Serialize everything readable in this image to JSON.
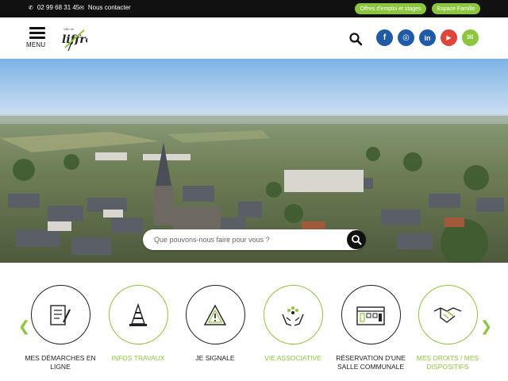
{
  "topbar": {
    "phone": "02 99 68 31 45",
    "contact_label": "Nous contacter",
    "jobs_label": "Offres d'emploi et stages",
    "family_label": "Espace Famille"
  },
  "header": {
    "menu_label": "MENU",
    "logo_text": "liffré",
    "logo_small": "Ville de"
  },
  "social": {
    "facebook": "f",
    "instagram": "◎",
    "linkedin": "in",
    "youtube": "▶",
    "mail": "✉"
  },
  "search": {
    "placeholder": "Que pouvons-nous faire pour vous ?"
  },
  "quick_links": [
    {
      "label": "MES DÉMARCHES EN LIGNE",
      "icon": "forms-icon"
    },
    {
      "label": "INFOS TRAVAUX",
      "icon": "traffic-cone-icon"
    },
    {
      "label": "JE SIGNALE",
      "icon": "warning-icon"
    },
    {
      "label": "VIE ASSOCIATIVE",
      "icon": "hands-community-icon"
    },
    {
      "label": "RÉSERVATION D'UNE SALLE COMMUNALE",
      "icon": "building-icon"
    },
    {
      "label": "MES DROITS / MES DISPOSITIFS",
      "icon": "handshake-icon"
    }
  ],
  "colors": {
    "accent_green": "#8cc63f",
    "social_blue": "#1f5aa6",
    "youtube_red": "#e0453a",
    "topbar_bg": "#111111"
  }
}
